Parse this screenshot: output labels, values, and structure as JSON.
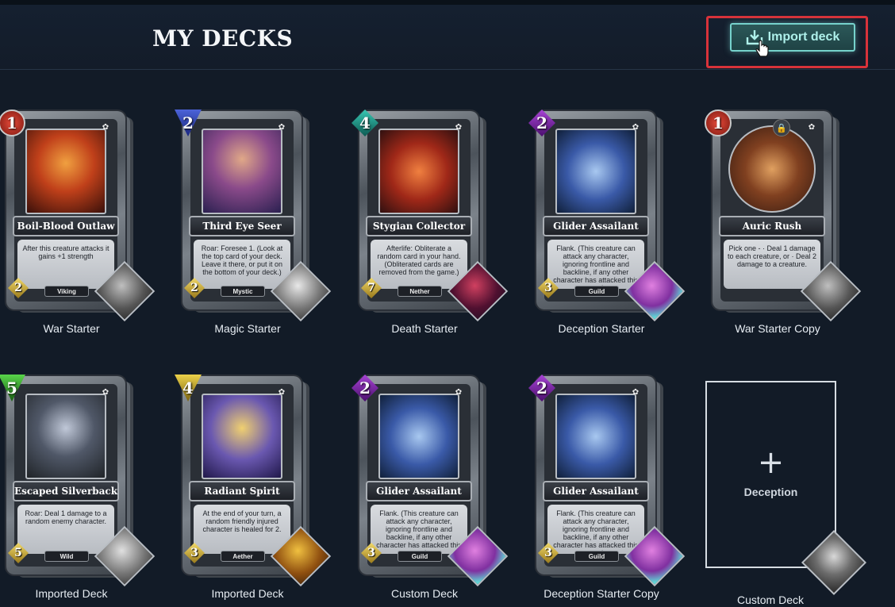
{
  "header": {
    "title": "MY DECKS",
    "import_label": "Import deck",
    "accent": "#76d2cc",
    "highlight": "#d8323a"
  },
  "decks": [
    {
      "label": "War Starter",
      "card": {
        "name": "Boil-Blood Outlaw",
        "mana": "1",
        "cost": "2",
        "tribe": "Viking",
        "text": "After this creature attacks it gains +1 strength",
        "gem": "red"
      }
    },
    {
      "label": "Magic Starter",
      "card": {
        "name": "Third Eye Seer",
        "mana": "2",
        "cost": "2",
        "tribe": "Mystic",
        "text": "Roar: Foresee 1. (Look at the top card of your deck. Leave it there, or put it on the bottom of your deck.)",
        "gem": "blue"
      }
    },
    {
      "label": "Death Starter",
      "card": {
        "name": "Stygian Collector",
        "mana": "4",
        "cost": "7",
        "tribe": "Nether",
        "text": "Afterlife: Obliterate a random card in your hand. (Obliterated cards are removed from the game.)",
        "gem": "teal"
      }
    },
    {
      "label": "Deception Starter",
      "card": {
        "name": "Glider Assailant",
        "mana": "2",
        "cost": "3",
        "tribe": "Guild",
        "text": "Flank. (This creature can attack any character, ignoring frontline and backline, if any other character has attacked this turn.)",
        "gem": "purple"
      }
    },
    {
      "label": "War Starter Copy",
      "card": {
        "name": "Auric Rush",
        "mana": "1",
        "text": "Pick one - · Deal 1 damage to each creature, or · Deal 2 damage to a creature.",
        "gem": "red"
      }
    },
    {
      "label": "Imported Deck",
      "card": {
        "name": "Escaped Silverback",
        "mana": "5",
        "cost": "5",
        "tribe": "Wild",
        "text": "Roar: Deal 1 damage to a random enemy character.",
        "gem": "green"
      }
    },
    {
      "label": "Imported Deck",
      "card": {
        "name": "Radiant Spirit",
        "mana": "4",
        "cost": "3",
        "tribe": "Aether",
        "text": "At the end of your turn, a random friendly injured character is healed for 2.",
        "gem": "yellow"
      }
    },
    {
      "label": "Custom Deck",
      "card": {
        "name": "Glider Assailant",
        "mana": "2",
        "cost": "3",
        "tribe": "Guild",
        "text": "Flank. (This creature can attack any character, ignoring frontline and backline, if any other character has attacked this turn.)",
        "gem": "purple"
      }
    },
    {
      "label": "Deception Starter Copy",
      "card": {
        "name": "Glider Assailant",
        "mana": "2",
        "cost": "3",
        "tribe": "Guild",
        "text": "Flank. (This creature can attack any character, ignoring frontline and backline, if any other character has attacked this turn.)",
        "gem": "purple"
      }
    }
  ],
  "new_deck": {
    "plus": "+",
    "god": "Deception",
    "label": "Custom Deck"
  },
  "icons": [
    "download-icon",
    "cursor-icon",
    "plus-icon",
    "lock-icon",
    "rarity-icon"
  ]
}
